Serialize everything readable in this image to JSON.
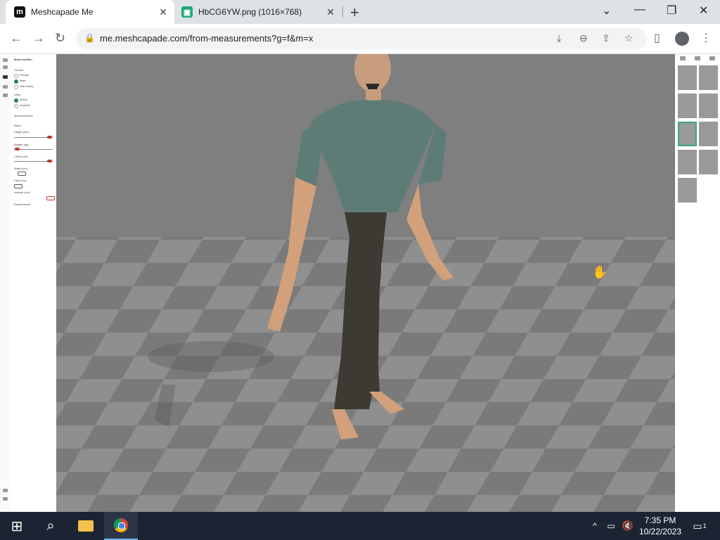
{
  "tabs": [
    {
      "label": "Meshcapade Me",
      "favicon": "m",
      "favicon_color": "#111111",
      "active": true
    },
    {
      "label": "HbCG6YW.png (1016×768)",
      "favicon": "▣",
      "favicon_color": "#1aa879",
      "active": false
    }
  ],
  "address": {
    "url": "me.meshcapade.com/from-measurements?g=f&m=x"
  },
  "left_panel": {
    "header": "Meta modifier",
    "gender_label": "Gender",
    "gender_options": [
      "Female",
      "Male",
      "Non-binary"
    ],
    "gender_selected": "Male",
    "units_label": "Units",
    "unit_options": [
      "Metric",
      "Imperial"
    ],
    "unit_selected": "Metric",
    "measurements_label": "Measurements",
    "basic_label": "Basic",
    "fields": [
      "Height (cm)",
      "Weight (kg)",
      "Chest (cm)",
      "Waist (cm)",
      "Hips (cm)",
      "Inseam (cm)"
    ],
    "experimental_label": "Experimental"
  },
  "taskbar": {
    "time": "7:35 PM",
    "date": "10/22/2023",
    "notification_count": "1"
  },
  "colors": {
    "accent": "#2e7d5b",
    "slider_knob": "#c0392b",
    "taskbar": "#1c2433",
    "viewport_floor": "#8a8a8a"
  }
}
